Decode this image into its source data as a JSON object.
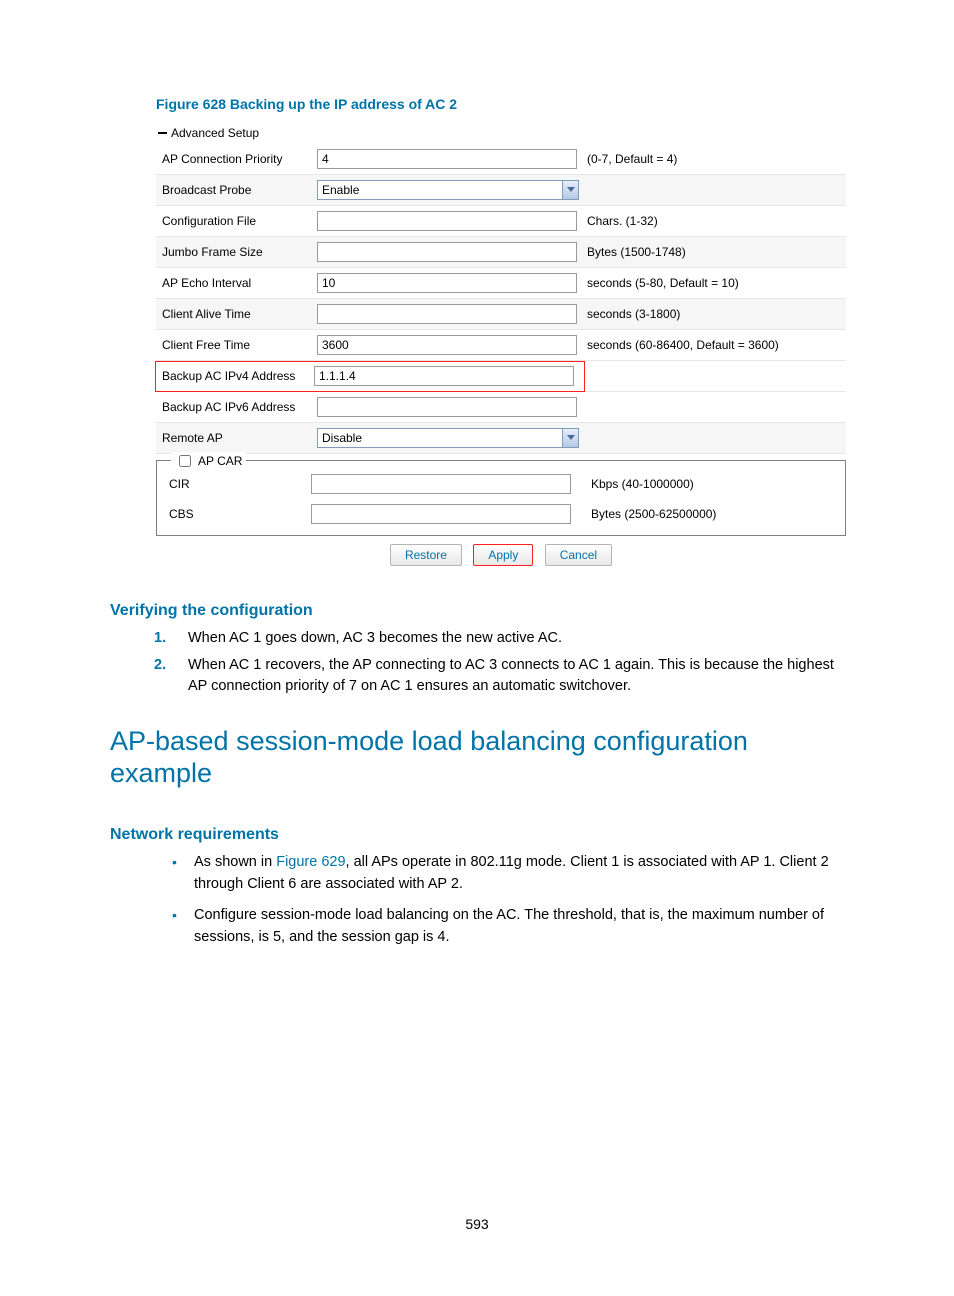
{
  "figure_caption": "Figure 628 Backing up the IP address of AC 2",
  "ui": {
    "advanced_setup": "Advanced Setup",
    "rows": {
      "ap_conn_priority": {
        "label": "AP Connection Priority",
        "value": "4",
        "hint": "(0-7, Default = 4)"
      },
      "broadcast_probe": {
        "label": "Broadcast Probe",
        "value": "Enable"
      },
      "config_file": {
        "label": "Configuration File",
        "value": "",
        "hint": "Chars. (1-32)"
      },
      "jumbo_frame": {
        "label": "Jumbo Frame Size",
        "value": "",
        "hint": "Bytes (1500-1748)"
      },
      "ap_echo": {
        "label": "AP Echo Interval",
        "value": "10",
        "hint": "seconds (5-80, Default = 10)"
      },
      "client_alive": {
        "label": "Client Alive Time",
        "value": "",
        "hint": "seconds (3-1800)"
      },
      "client_free": {
        "label": "Client Free Time",
        "value": "3600",
        "hint": "seconds (60-86400, Default = 3600)"
      },
      "backup_v4": {
        "label": "Backup AC IPv4 Address",
        "value": "1.1.1.4"
      },
      "backup_v6": {
        "label": "Backup AC IPv6 Address",
        "value": ""
      },
      "remote_ap": {
        "label": "Remote AP",
        "value": "Disable"
      }
    },
    "apcar": {
      "legend": "AP CAR",
      "cir": {
        "label": "CIR",
        "value": "",
        "hint": "Kbps (40-1000000)"
      },
      "cbs": {
        "label": "CBS",
        "value": "",
        "hint": "Bytes (2500-62500000)"
      }
    },
    "buttons": {
      "restore": "Restore",
      "apply": "Apply",
      "cancel": "Cancel"
    }
  },
  "verify_heading": "Verifying the configuration",
  "verify_items": [
    "When AC 1 goes down, AC 3 becomes the new active AC.",
    "When AC 1 recovers, the AP connecting to AC 3 connects to AC 1 again. This is because the highest AP connection priority of 7 on AC 1 ensures an automatic switchover."
  ],
  "h2": "AP-based session-mode load balancing configuration example",
  "netreq_heading": "Network requirements",
  "netreq_items_pre": "As shown in ",
  "netreq_link": "Figure 629",
  "netreq_items_post": ", all APs operate in 802.11g mode. Client 1 is associated with AP 1. Client 2 through Client 6 are associated with AP 2.",
  "netreq_item2": "Configure session-mode load balancing on the AC. The threshold, that is, the maximum number of sessions, is 5, and the session gap is 4.",
  "page_number": "593"
}
